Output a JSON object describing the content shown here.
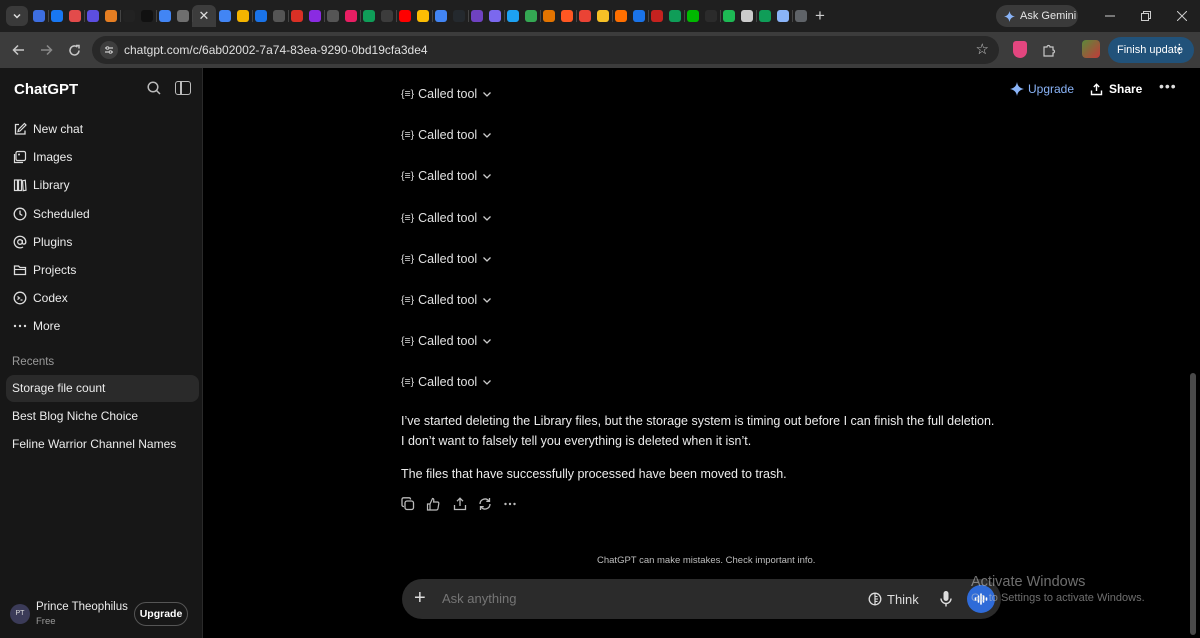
{
  "browser": {
    "url": "chatgpt.com/c/6ab02002-7a74-83ea-9290-0bd19cfa3de4",
    "ask_gemini_label": "Ask Gemini",
    "finish_update_label": "Finish update",
    "new_tab_label": "+",
    "close_tab_label": "✕",
    "tab_favicon_colors": [
      "#3d6ee0",
      "#1877f2",
      "#e34b4b",
      "#5c4ee0",
      "#e67e22",
      "#222222",
      "#111111",
      "#4285f4",
      "#6f6f6f",
      "#4285f4",
      "#f4b400",
      "#1a73e8",
      "#555555",
      "#d93025",
      "#8a2be2",
      "#555555",
      "#e91e63",
      "#0f9d58",
      "#3c3c3c",
      "#ff0000",
      "#fbbc04",
      "#4285f4",
      "#24292e",
      "#6f42c1",
      "#7b68ee",
      "#1da1f2",
      "#34a853",
      "#e37400",
      "#ff5722",
      "#ea4335",
      "#f6c026",
      "#ff6f00",
      "#1a73e8",
      "#c5221f",
      "#0f9d58",
      "#00b900",
      "#2b2b2b",
      "#1db954",
      "#cccccc",
      "#0f9d58",
      "#8ab4f8",
      "#5f6368"
    ]
  },
  "sidebar": {
    "brand": "ChatGPT",
    "nav": [
      {
        "label": "New chat",
        "icon": "new-chat-icon"
      },
      {
        "label": "Images",
        "icon": "images-icon"
      },
      {
        "label": "Library",
        "icon": "library-icon"
      },
      {
        "label": "Scheduled",
        "icon": "clock-icon"
      },
      {
        "label": "Plugins",
        "icon": "at-icon"
      },
      {
        "label": "Projects",
        "icon": "folder-icon"
      },
      {
        "label": "Codex",
        "icon": "codex-icon"
      },
      {
        "label": "More",
        "icon": "ellipsis-icon"
      }
    ],
    "recents_label": "Recents",
    "recents": [
      {
        "label": "Storage file count",
        "active": true
      },
      {
        "label": "Best Blog Niche Choice",
        "active": false
      },
      {
        "label": "Feline Warrior Channel Names",
        "active": false
      }
    ],
    "user": {
      "initials": "PT",
      "name": "Prince Theophilus",
      "plan": "Free",
      "upgrade_label": "Upgrade"
    }
  },
  "header": {
    "upgrade_label": "Upgrade",
    "share_label": "Share",
    "more_label": "•••"
  },
  "conversation": {
    "tool_calls": [
      {
        "label": "Called tool"
      },
      {
        "label": "Called tool"
      },
      {
        "label": "Called tool"
      },
      {
        "label": "Called tool"
      },
      {
        "label": "Called tool"
      },
      {
        "label": "Called tool"
      },
      {
        "label": "Called tool"
      },
      {
        "label": "Called tool"
      }
    ],
    "message_lines": [
      "I’ve started deleting the Library files, but the storage system is timing out before I can finish the full deletion.",
      "I don’t want to falsely tell you everything is deleted when it isn’t."
    ],
    "message_second": "The files that have successfully processed have been moved to trash.",
    "action_icons": [
      "copy-icon",
      "thumbs-icon",
      "share-icon",
      "regenerate-icon",
      "more-icon"
    ]
  },
  "composer": {
    "placeholder": "Ask anything",
    "think_label": "Think",
    "disclaimer": "ChatGPT can make mistakes. Check important info."
  },
  "watermark": {
    "title": "Activate Windows",
    "subtitle": "Go to Settings to activate Windows."
  }
}
